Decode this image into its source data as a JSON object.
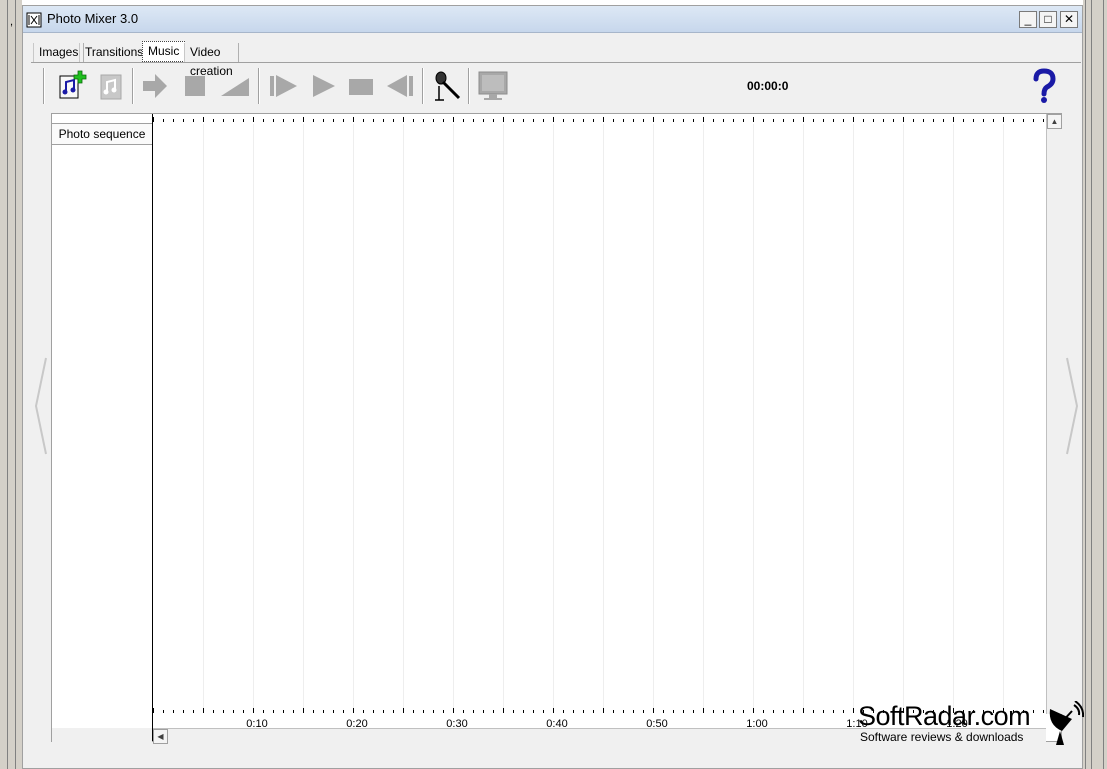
{
  "window": {
    "title": "Photo Mixer 3.0",
    "controls": {
      "minimize": "_",
      "maximize": "□",
      "close": "✕"
    }
  },
  "tabs": [
    {
      "label": "Images"
    },
    {
      "label": "Transitions"
    },
    {
      "label": "Music",
      "active": true
    },
    {
      "label": "Video creation"
    }
  ],
  "toolbar": {
    "buttons": [
      {
        "icon": "add-music-icon",
        "enabled": true
      },
      {
        "icon": "music-file-icon",
        "enabled": false
      },
      {
        "icon": "arrow-right-icon",
        "enabled": false
      },
      {
        "icon": "stop-square-icon",
        "enabled": false
      },
      {
        "icon": "volume-ramp-icon",
        "enabled": false
      },
      {
        "icon": "play-from-start-icon",
        "enabled": false
      },
      {
        "icon": "play-icon",
        "enabled": false
      },
      {
        "icon": "stop-icon",
        "enabled": false
      },
      {
        "icon": "rewind-icon",
        "enabled": false
      },
      {
        "icon": "microphone-icon",
        "enabled": true
      },
      {
        "icon": "monitor-icon",
        "enabled": false
      }
    ],
    "time_display": "00:00:0",
    "help_icon": "help-question-icon"
  },
  "timeline": {
    "track_label": "Photo sequence",
    "time_labels": [
      "0:10",
      "0:20",
      "0:30",
      "0:40",
      "0:50",
      "1:00",
      "1:10",
      "1:20"
    ]
  },
  "watermark": {
    "title": "SoftRadar.com",
    "subtitle": "Software reviews & downloads"
  },
  "colors": {
    "titlebar": "#c7d7ec",
    "icon_blue": "#1a1aa6",
    "disabled_gray": "#a8a8a8",
    "add_green": "#1fbf1f"
  }
}
